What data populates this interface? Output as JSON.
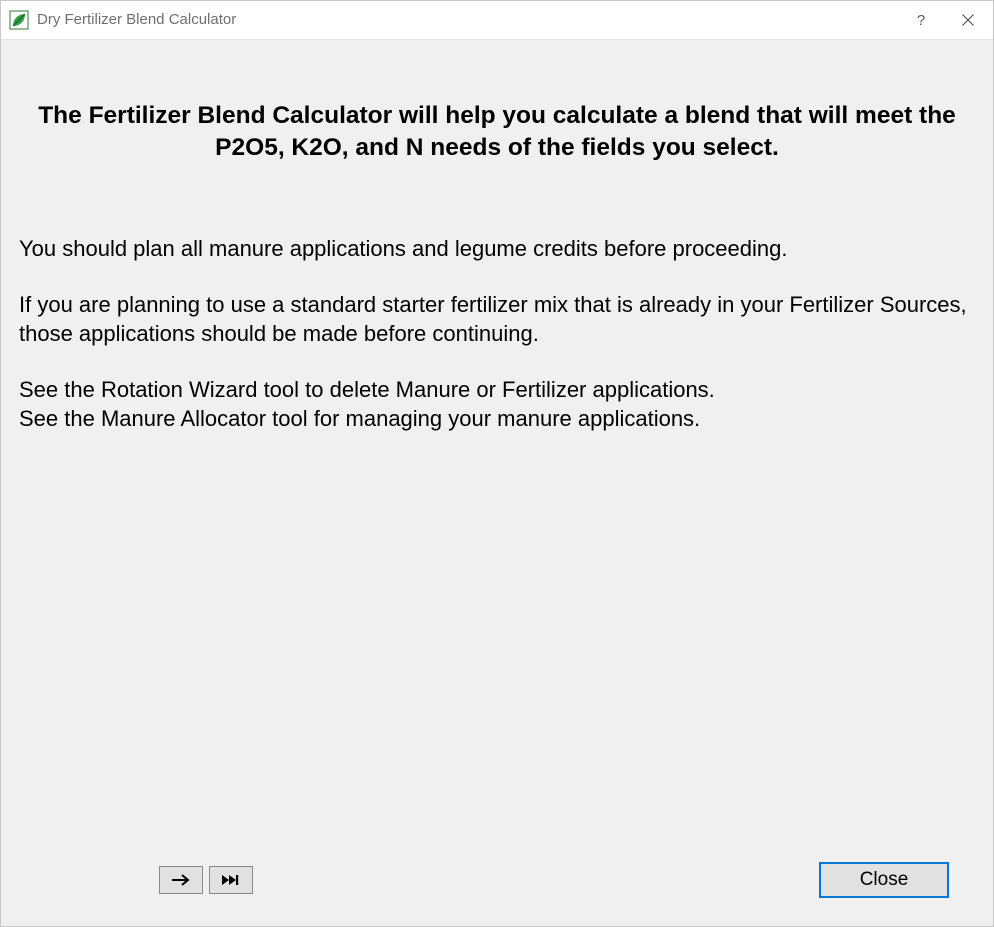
{
  "window": {
    "title": "Dry Fertilizer Blend Calculator"
  },
  "heading": "The Fertilizer Blend Calculator will help you calculate a blend that will meet the P2O5, K2O, and N needs of the fields you select.",
  "paragraphs": {
    "p1": "You should plan all manure applications and legume credits before proceeding.",
    "p2": "If you are planning to use a standard starter fertilizer mix that is already in your Fertilizer Sources, those applications should be made before continuing.",
    "p3a": "See the Rotation Wizard tool to delete Manure or Fertilizer applications.",
    "p3b": "See the Manure Allocator tool for managing your manure applications."
  },
  "footer": {
    "close_label": "Close"
  },
  "icons": {
    "help": "?",
    "next": "next-arrow-icon",
    "skip": "skip-to-end-icon"
  }
}
